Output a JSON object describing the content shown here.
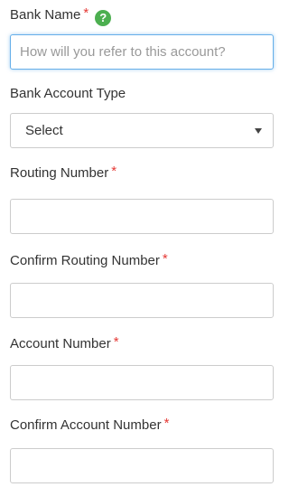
{
  "bank_name": {
    "label": "Bank Name",
    "required_mark": "*",
    "help_icon": "question-circle-icon",
    "placeholder": "How will you refer to this account?",
    "value": ""
  },
  "account_type": {
    "label": "Bank Account Type",
    "selected": "Select"
  },
  "routing_number": {
    "label": "Routing Number",
    "required_mark": "*",
    "value": ""
  },
  "confirm_routing_number": {
    "label": "Confirm Routing Number",
    "required_mark": "*",
    "value": ""
  },
  "account_number": {
    "label": "Account Number",
    "required_mark": "*",
    "value": ""
  },
  "confirm_account_number": {
    "label": "Confirm Account Number",
    "required_mark": "*",
    "value": ""
  },
  "colors": {
    "required": "#e53935",
    "help_icon": "#4caf50",
    "focus_border": "#66afe9"
  }
}
